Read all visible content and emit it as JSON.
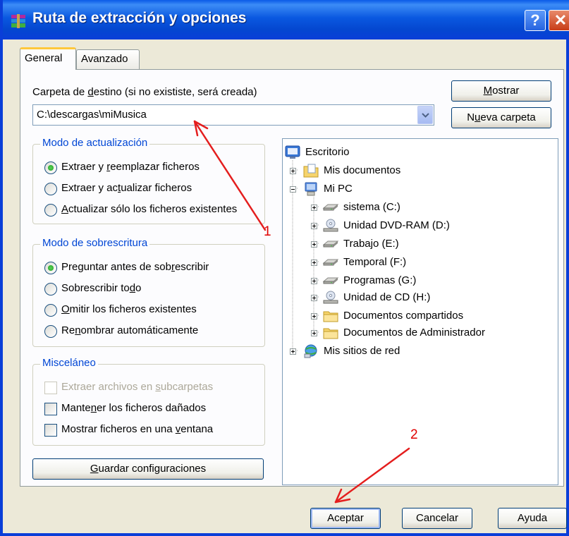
{
  "window": {
    "title": "Ruta de extracción y opciones",
    "help_glyph": "?",
    "close_glyph": "✕"
  },
  "tabs": [
    {
      "label": "General",
      "active": true
    },
    {
      "label": "Avanzado",
      "active": false
    }
  ],
  "destination": {
    "label_pre": "Carpeta de ",
    "label_key": "d",
    "label_post": "estino (si no exististe, será creada)",
    "value": "C:\\descargas\\miMusica"
  },
  "buttons": {
    "show_key": "M",
    "show_rest": "ostrar",
    "new_folder_pre": "N",
    "new_folder_key": "u",
    "new_folder_post": "eva carpeta",
    "save_key": "G",
    "save_rest": "uardar configuraciones",
    "ok": "Aceptar",
    "cancel": "Cancelar",
    "help": "Ayuda"
  },
  "update_mode": {
    "title": "Modo de actualización",
    "options": [
      {
        "pre": "Extraer y ",
        "key": "r",
        "post": "eemplazar ficheros",
        "selected": true
      },
      {
        "pre": "Extraer y ac",
        "key": "t",
        "post": "ualizar ficheros",
        "selected": false
      },
      {
        "pre": "",
        "key": "A",
        "post": "ctualizar sólo los ficheros existentes",
        "selected": false
      }
    ]
  },
  "overwrite_mode": {
    "title": "Modo de sobrescritura",
    "options": [
      {
        "pre": "Preguntar antes de sob",
        "key": "r",
        "post": "escribir",
        "selected": true
      },
      {
        "pre": "Sobrescribir to",
        "key": "d",
        "post": "o",
        "selected": false
      },
      {
        "pre": "",
        "key": "O",
        "post": "mitir los ficheros existentes",
        "selected": false
      },
      {
        "pre": "Re",
        "key": "n",
        "post": "ombrar automáticamente",
        "selected": false
      }
    ]
  },
  "misc": {
    "title": "Misceláneo",
    "options": [
      {
        "pre": "Extraer archivos en ",
        "key": "s",
        "post": "ubcarpetas",
        "checked": false,
        "disabled": true
      },
      {
        "pre": "Mante",
        "key": "n",
        "post": "er los ficheros dañados",
        "checked": false,
        "disabled": false
      },
      {
        "pre": "Mostrar ficheros en una ",
        "key": "v",
        "post": "entana",
        "checked": false,
        "disabled": false
      }
    ]
  },
  "tree": [
    {
      "label": "Escritorio",
      "icon": "desktop-icon"
    },
    {
      "label": "Mis documentos",
      "icon": "my-documents-icon"
    },
    {
      "label": "Mi PC",
      "icon": "my-computer-icon"
    },
    {
      "label": "sistema (C:)",
      "icon": "hard-drive-icon"
    },
    {
      "label": "Unidad DVD-RAM (D:)",
      "icon": "optical-drive-icon"
    },
    {
      "label": "Trabajo (E:)",
      "icon": "hard-drive-icon"
    },
    {
      "label": "Temporal (F:)",
      "icon": "hard-drive-icon"
    },
    {
      "label": "Programas (G:)",
      "icon": "hard-drive-icon"
    },
    {
      "label": "Unidad de CD (H:)",
      "icon": "optical-drive-icon"
    },
    {
      "label": "Documentos compartidos",
      "icon": "folder-icon"
    },
    {
      "label": "Documentos de Administrador",
      "icon": "folder-icon"
    },
    {
      "label": "Mis sitios de red",
      "icon": "network-places-icon"
    }
  ],
  "annotations": {
    "marker_1": "1",
    "marker_2": "2"
  }
}
